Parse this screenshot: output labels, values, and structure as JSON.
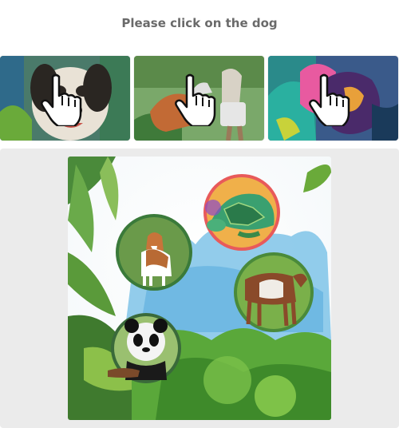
{
  "captcha": {
    "instruction": "Please click on the dog",
    "thumbnails": [
      {
        "subject": "dog-face",
        "icon": "pointer-hand-icon"
      },
      {
        "subject": "dog-and-boxer",
        "icon": "pointer-hand-icon"
      },
      {
        "subject": "colorful-dog",
        "icon": "pointer-hand-icon"
      }
    ],
    "scene": {
      "subjects": [
        "dog",
        "turtle",
        "cow",
        "panda"
      ],
      "background": "watercolor jungle"
    }
  },
  "colors": {
    "panel_bg": "#ebebeb",
    "instruction_text": "#6a6a6a"
  }
}
